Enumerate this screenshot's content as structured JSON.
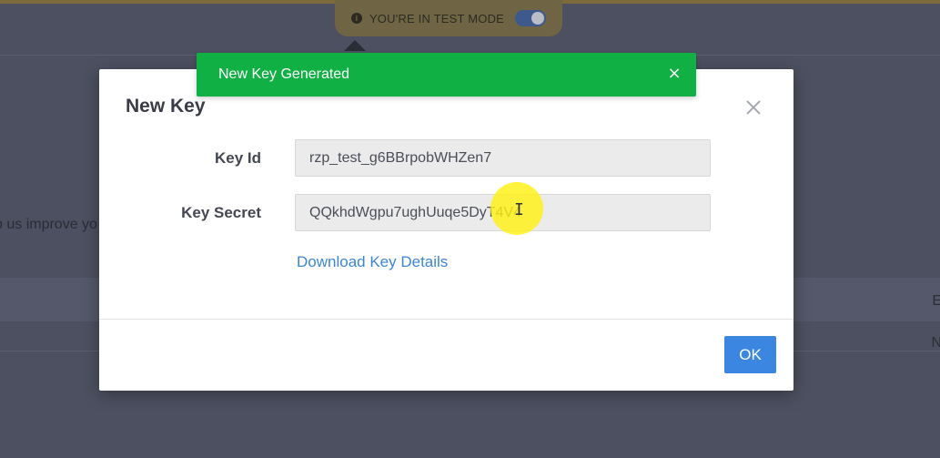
{
  "background": {
    "partial_text": "p us improve yo",
    "right_letter_1": "E",
    "right_letter_2": "N"
  },
  "test_banner": {
    "info_icon": "i",
    "text": "YOU'RE IN TEST MODE",
    "toggle_on": true
  },
  "toast": {
    "message": "New Key Generated",
    "close_glyph": "×",
    "color": "#10b044"
  },
  "modal": {
    "title": "New Key",
    "fields": [
      {
        "label": "Key Id",
        "value": "rzp_test_g6BBrpobWHZen7"
      },
      {
        "label": "Key Secret",
        "value": "QQkhdWgpu7ughUuqe5DyT4V4"
      }
    ],
    "download_link": "Download Key Details",
    "ok_label": "OK"
  },
  "colors": {
    "accent": "#3b86e0",
    "link": "#3d86d4",
    "overlay": "#4d5060"
  }
}
